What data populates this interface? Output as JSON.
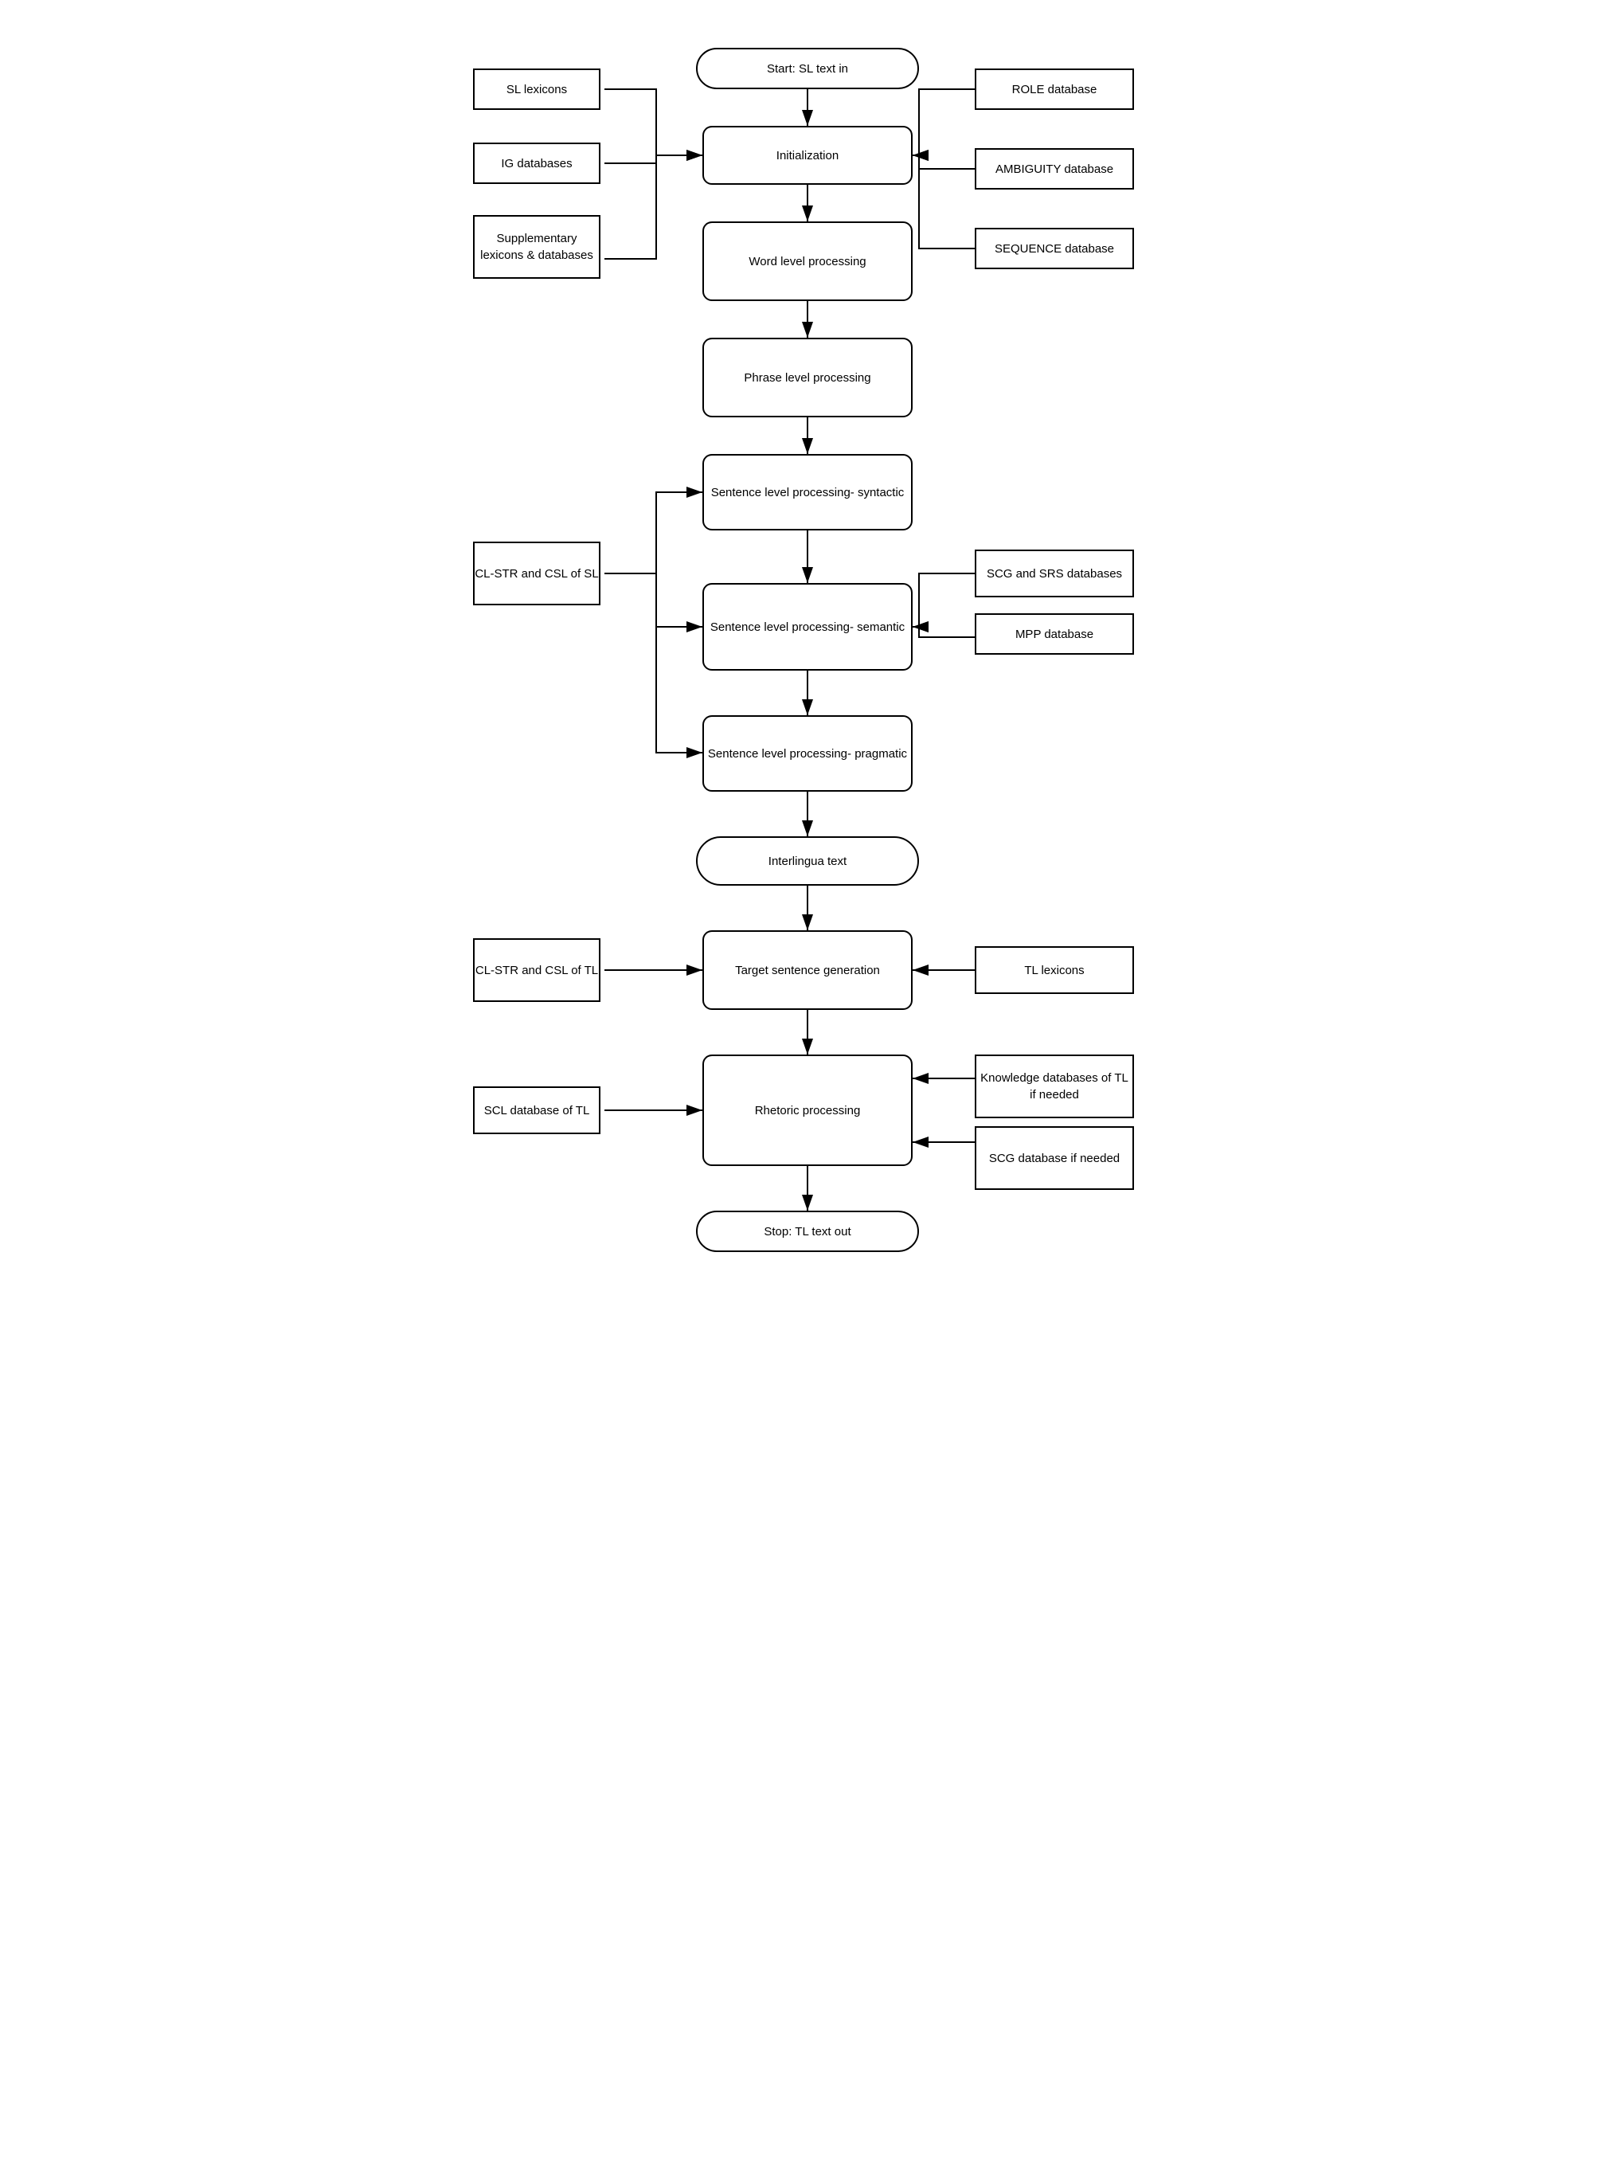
{
  "nodes": {
    "start": {
      "label": "Start: SL text in"
    },
    "initialization": {
      "label": "Initialization"
    },
    "word_level": {
      "label": "Word level processing"
    },
    "phrase_level": {
      "label": "Phrase level processing"
    },
    "sentence_syntactic": {
      "label": "Sentence level processing- syntactic"
    },
    "sentence_semantic": {
      "label": "Sentence level processing- semantic"
    },
    "sentence_pragmatic": {
      "label": "Sentence level processing- pragmatic"
    },
    "interlingua": {
      "label": "Interlingua text"
    },
    "target_sentence": {
      "label": "Target sentence generation"
    },
    "rhetoric": {
      "label": "Rhetoric processing"
    },
    "stop": {
      "label": "Stop: TL text out"
    },
    "sl_lexicons": {
      "label": "SL lexicons"
    },
    "ig_databases": {
      "label": "IG databases"
    },
    "supplementary": {
      "label": "Supplementary lexicons & databases"
    },
    "role_db": {
      "label": "ROLE database"
    },
    "ambiguity_db": {
      "label": "AMBIGUITY database"
    },
    "sequence_db": {
      "label": "SEQUENCE database"
    },
    "cl_str_sl": {
      "label": "CL-STR and CSL of   SL"
    },
    "scg_srs_db": {
      "label": "SCG and SRS databases"
    },
    "mpp_db": {
      "label": "MPP database"
    },
    "cl_str_tl": {
      "label": "CL-STR and CSL of   TL"
    },
    "tl_lexicons": {
      "label": "TL lexicons"
    },
    "scl_db_tl": {
      "label": "SCL database of TL"
    },
    "knowledge_db": {
      "label": "Knowledge databases of TL if needed"
    },
    "scg_db_needed": {
      "label": "SCG database if needed"
    }
  }
}
